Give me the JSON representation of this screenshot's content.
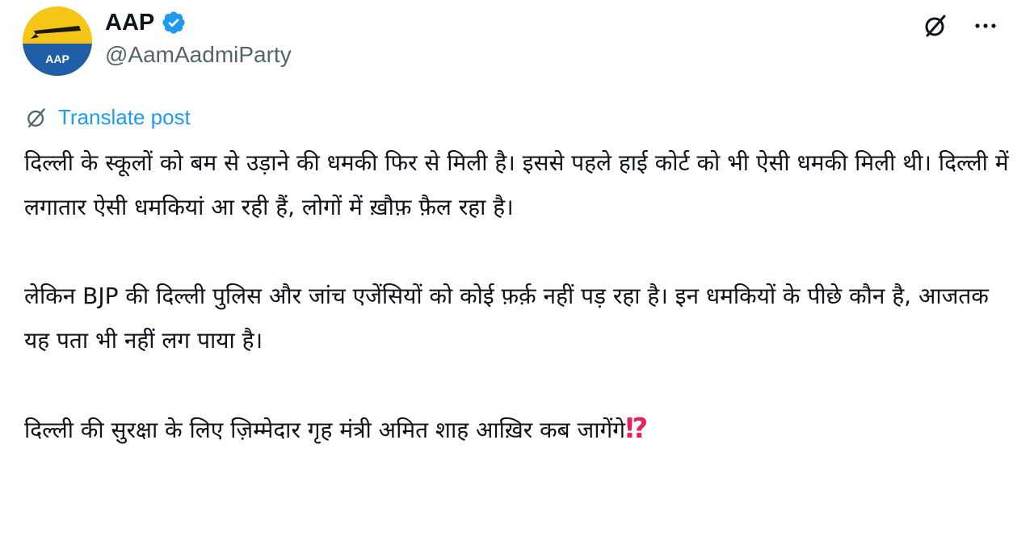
{
  "author": {
    "display_name": "AAP",
    "handle": "@AamAadmiParty",
    "avatar_text": "AAP",
    "verified": true
  },
  "icons": {
    "grok": "grok-icon",
    "more": "more-icon",
    "more_glyph": "···",
    "translate": "grok-icon",
    "verified": "verified-badge-icon"
  },
  "translate": {
    "label": "Translate post"
  },
  "post": {
    "paragraphs": [
      "दिल्ली के स्कूलों को बम से उड़ाने की धमकी फिर से मिली है। इससे पहले हाई कोर्ट को भी ऐसी धमकी मिली थी। दिल्ली में लगातार ऐसी धमकियां आ रही हैं, लोगों में ख़ौफ़ फ़ैल रहा है।",
      "लेकिन BJP की दिल्ली पुलिस और जांच एजेंसियों को कोई फ़र्क़ नहीं पड़ रहा है। इन धमकियों के पीछे कौन है, आजतक यह पता भी नहीं लग पाया है।",
      "दिल्ली की सुरक्षा के लिए ज़िम्मेदार गृह मंत्री अमित शाह आख़िर कब जागेंगे"
    ],
    "trailing_emoji": "⁉"
  },
  "colors": {
    "accent": "#1d9bf0",
    "secondary_text": "#536471",
    "avatar_yellow": "#f5c518",
    "avatar_blue": "#1f5fa8",
    "emoji_red": "#e0245e"
  }
}
